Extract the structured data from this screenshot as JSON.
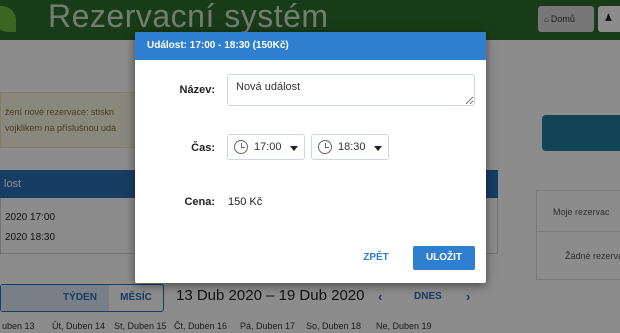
{
  "app": {
    "title": "Rezervacní systém"
  },
  "nav": {
    "home_label": "Domů",
    "home_icon": "home-icon",
    "user_icon": "user-icon"
  },
  "notice": {
    "line1": "žení nové rezervace: stiskn",
    "line2": "vojklikem na příslušnou udá"
  },
  "event_panel": {
    "heading": "lost",
    "from": "2020 17:00",
    "to": "2020 18:30"
  },
  "sidebar": {
    "title": "Moje rezervac",
    "empty": "Žádné rezerva"
  },
  "calendar": {
    "view_week": "TÝDEN",
    "view_month": "MĚSÍC",
    "range": "13 Dub 2020 – 19 Dub 2020",
    "prev": "‹",
    "today": "DNES",
    "next": "›",
    "days": [
      "uben 13",
      "Út, Duben 14",
      "St, Duben 15",
      "Čt, Duben 16",
      "Pá, Duben 17",
      "So, Duben 18",
      "Ne, Duben 19"
    ]
  },
  "modal": {
    "title": "Událost: 17:00 - 18:30 (150Kč)",
    "name_label": "Název:",
    "name_value": "Nová událost",
    "time_label": "Čas:",
    "time_from": "17:00",
    "time_to": "18:30",
    "price_label": "Cena:",
    "price_value": "150 Kč",
    "back_label": "ZPĚT",
    "save_label": "ULOŽIT"
  },
  "colors": {
    "modal_header": "#2f7fd0",
    "save_button": "#2f7fd0",
    "topbar": "#2f6e2c",
    "event_header": "#2b6fb6"
  }
}
